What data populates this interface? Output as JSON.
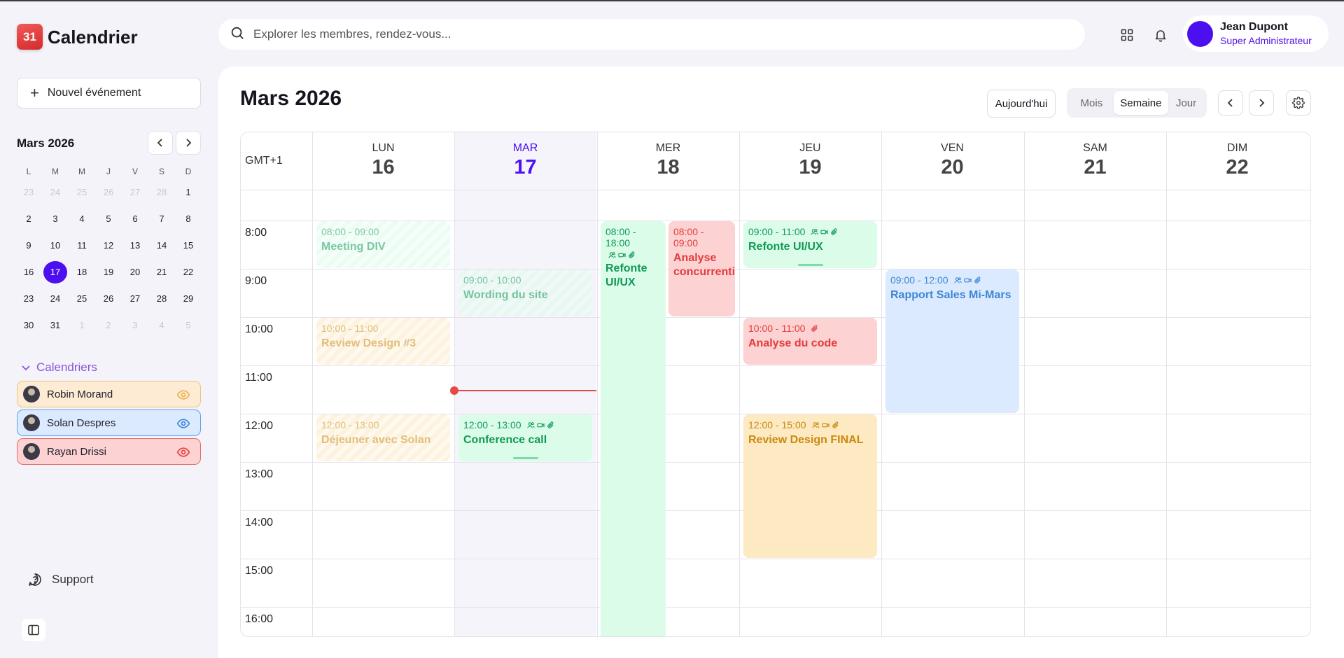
{
  "app": {
    "logo_text": "31",
    "title": "Calendrier"
  },
  "search": {
    "placeholder": "Explorer les membres, rendez-vous..."
  },
  "user": {
    "name": "Jean Dupont",
    "role": "Super Administrateur",
    "avatar_color": "#4c0ff0"
  },
  "sidebar": {
    "new_event_label": "Nouvel événement",
    "mini_calendar": {
      "title": "Mars 2026",
      "weekdays": [
        "L",
        "M",
        "M",
        "J",
        "V",
        "S",
        "D"
      ],
      "weeks": [
        [
          {
            "d": "23",
            "muted": true
          },
          {
            "d": "24",
            "muted": true
          },
          {
            "d": "25",
            "muted": true
          },
          {
            "d": "26",
            "muted": true
          },
          {
            "d": "27",
            "muted": true
          },
          {
            "d": "28",
            "muted": true
          },
          {
            "d": "1"
          }
        ],
        [
          {
            "d": "2"
          },
          {
            "d": "3"
          },
          {
            "d": "4"
          },
          {
            "d": "5"
          },
          {
            "d": "6"
          },
          {
            "d": "7"
          },
          {
            "d": "8"
          }
        ],
        [
          {
            "d": "9"
          },
          {
            "d": "10"
          },
          {
            "d": "11"
          },
          {
            "d": "12"
          },
          {
            "d": "13"
          },
          {
            "d": "14"
          },
          {
            "d": "15"
          }
        ],
        [
          {
            "d": "16"
          },
          {
            "d": "17",
            "today": true
          },
          {
            "d": "18"
          },
          {
            "d": "19"
          },
          {
            "d": "20"
          },
          {
            "d": "21"
          },
          {
            "d": "22"
          }
        ],
        [
          {
            "d": "23"
          },
          {
            "d": "24"
          },
          {
            "d": "25"
          },
          {
            "d": "26"
          },
          {
            "d": "27"
          },
          {
            "d": "28"
          },
          {
            "d": "29"
          }
        ],
        [
          {
            "d": "30"
          },
          {
            "d": "31"
          },
          {
            "d": "1",
            "muted": true
          },
          {
            "d": "2",
            "muted": true
          },
          {
            "d": "3",
            "muted": true
          },
          {
            "d": "4",
            "muted": true
          },
          {
            "d": "5",
            "muted": true
          }
        ]
      ]
    },
    "calendars_label": "Calendriers",
    "calendars": [
      {
        "name": "Robin Morand",
        "bg": "#fdebd3",
        "border": "#f0c27a",
        "eye": "#e8b250"
      },
      {
        "name": "Solan Despres",
        "bg": "#dbeafe",
        "border": "#5aa4e6",
        "eye": "#3d86d6"
      },
      {
        "name": "Rayan Drissi",
        "bg": "#fdd2d2",
        "border": "#e86a6a",
        "eye": "#e23c3c"
      }
    ],
    "support_label": "Support"
  },
  "toolbar": {
    "month_title": "Mars 2026",
    "today_label": "Aujourd'hui",
    "views": [
      "Mois",
      "Semaine",
      "Jour"
    ],
    "active_view": "Semaine"
  },
  "week": {
    "timezone": "GMT+1",
    "days": [
      {
        "name": "LUN",
        "num": "16"
      },
      {
        "name": "MAR",
        "num": "17",
        "today": true
      },
      {
        "name": "MER",
        "num": "18"
      },
      {
        "name": "JEU",
        "num": "19"
      },
      {
        "name": "VEN",
        "num": "20"
      },
      {
        "name": "SAM",
        "num": "21"
      },
      {
        "name": "DIM",
        "num": "22"
      }
    ],
    "hours": [
      "8:00",
      "9:00",
      "10:00",
      "11:00",
      "12:00",
      "13:00",
      "14:00",
      "15:00",
      "16:00"
    ],
    "now_time": "11:30",
    "events": [
      {
        "day": 0,
        "start": 8,
        "end": 9,
        "time": "08:00 - 09:00",
        "title": "Meeting DIV",
        "color": "green",
        "faded": true,
        "striped": true,
        "icons": false
      },
      {
        "day": 0,
        "start": 10,
        "end": 11,
        "time": "10:00 - 11:00",
        "title": "Review Design #3",
        "color": "yellow",
        "faded": true,
        "striped": true,
        "icons": false
      },
      {
        "day": 0,
        "start": 12,
        "end": 13,
        "time": "12:00 - 13:00",
        "title": "Déjeuner avec Solan",
        "color": "yellow",
        "faded": true,
        "striped": true,
        "icons": false
      },
      {
        "day": 1,
        "start": 9,
        "end": 10,
        "time": "09:00 - 10:00",
        "title": "Wording du site",
        "color": "green",
        "faded": true,
        "striped": true,
        "icons": false
      },
      {
        "day": 1,
        "start": 12,
        "end": 13,
        "time": "12:00 - 13:00",
        "title": "Conference call",
        "color": "green",
        "icons": true,
        "handle": true
      },
      {
        "day": 2,
        "start": 8,
        "end": 17,
        "time": "08:00 - 18:00",
        "title": "Refonte UI/UX",
        "color": "green",
        "icons": true,
        "half": "left"
      },
      {
        "day": 2,
        "start": 8,
        "end": 10,
        "time": "08:00 - 09:00",
        "title": "Analyse concurrentielle",
        "color": "red",
        "half": "right",
        "icons": false
      },
      {
        "day": 3,
        "start": 8,
        "end": 9,
        "time": "09:00 - 11:00",
        "title": "Refonte UI/UX",
        "color": "green",
        "icons": true,
        "handle": true
      },
      {
        "day": 3,
        "start": 10,
        "end": 11,
        "time": "10:00 - 11:00",
        "title": "Analyse du code",
        "color": "red",
        "icons": "clip"
      },
      {
        "day": 3,
        "start": 12,
        "end": 15,
        "time": "12:00 - 15:00",
        "title": "Review Design FINAL",
        "color": "yellow",
        "icons": true
      },
      {
        "day": 4,
        "start": 9,
        "end": 12,
        "time": "09:00 - 12:00",
        "title": "Rapport Sales Mi-Mars",
        "color": "blue",
        "icons": true
      }
    ]
  }
}
